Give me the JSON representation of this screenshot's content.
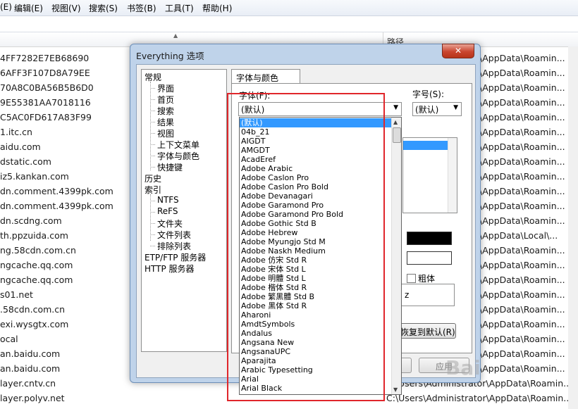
{
  "menu": [
    "(E)",
    "编辑(E)",
    "视图(V)",
    "搜索(S)",
    "书签(B)",
    "工具(T)",
    "帮助(H)"
  ],
  "list": {
    "path_header": "路径",
    "names": [
      "4FF7282E7EB68690",
      "6AFF3F107D8A79EE",
      "70A8C0BA56B5B6D0",
      "9E55381AA7018116",
      "C5AC0FD617A83F99",
      "1.itc.cn",
      "aidu.com",
      "dstatic.com",
      "iz5.kankan.com",
      "dn.comment.4399pk.com",
      "dn.comment.4399pk.com",
      "dn.scdng.com",
      "th.ppzuida.com",
      "ng.58cdn.com.cn",
      "ngcache.qq.com",
      "ngcache.qq.com",
      "s01.net",
      ".58cdn.com.cn",
      "exi.wysgtx.com",
      "ocal",
      "an.baidu.com",
      "an.baidu.com",
      "layer.cntv.cn",
      "layer.polyv.net"
    ],
    "paths": [
      "\\AppData\\Roamin...",
      "\\AppData\\Roamin...",
      "\\AppData\\Roamin...",
      "\\AppData\\Roamin...",
      "\\AppData\\Roamin...",
      "\\AppData\\Roamin...",
      "\\AppData\\Roamin...",
      "\\AppData\\Roamin...",
      "\\AppData\\Roamin...",
      "\\AppData\\Roamin...",
      "\\AppData\\Roamin...",
      "\\AppData\\Roamin...",
      "\\AppData\\Local\\...",
      "\\AppData\\Roamin...",
      "\\AppData\\Roamin...",
      "\\AppData\\Roamin...",
      "\\AppData\\Roamin...",
      "\\AppData\\Roamin...",
      "\\AppData\\Roamin...",
      "\\AppData\\Roamin...",
      "\\AppData\\Roamin...",
      "\\AppData\\Roamin...",
      "Users\\Administrator\\AppData\\Roamin...",
      "C:\\Users\\Administrator\\AppData\\Roamin..."
    ]
  },
  "dialog": {
    "title": "Everything 选项",
    "close_glyph": "✕",
    "tree": {
      "general": "常规",
      "general_children": [
        "界面",
        "首页",
        "搜索",
        "结果",
        "视图",
        "上下文菜单",
        "字体与颜色",
        "快捷键"
      ],
      "history": "历史",
      "index": "索引",
      "index_children": [
        "NTFS",
        "ReFS",
        "文件夹",
        "文件列表",
        "排除列表"
      ],
      "etp": "ETP/FTP 服务器",
      "http": "HTTP 服务器"
    },
    "tab": "字体与颜色",
    "font_label": "字体(F):",
    "font_value": "(默认)",
    "size_label": "字号(S):",
    "size_value": "(默认)",
    "bold_label": "粗体",
    "preview_text": "z",
    "restore_button": "恢复到默认(R)",
    "apply_button": "应用"
  },
  "font_list": [
    "(默认)",
    "04b_21",
    "AIGDT",
    "AMGDT",
    "AcadEref",
    "Adobe Arabic",
    "Adobe Caslon Pro",
    "Adobe Caslon Pro Bold",
    "Adobe Devanagari",
    "Adobe Garamond Pro",
    "Adobe Garamond Pro Bold",
    "Adobe Gothic Std B",
    "Adobe Hebrew",
    "Adobe Myungjo Std M",
    "Adobe Naskh Medium",
    "Adobe 仿宋 Std R",
    "Adobe 宋体 Std L",
    "Adobe 明體 Std L",
    "Adobe 楷体 Std R",
    "Adobe 繁黑體 Std B",
    "Adobe 黑体 Std R",
    "Aharoni",
    "AmdtSymbols",
    "Andalus",
    "Angsana New",
    "AngsanaUPC",
    "Aparajita",
    "Arabic Typesetting",
    "Arial",
    "Arial Black"
  ],
  "watermark": "Bai"
}
